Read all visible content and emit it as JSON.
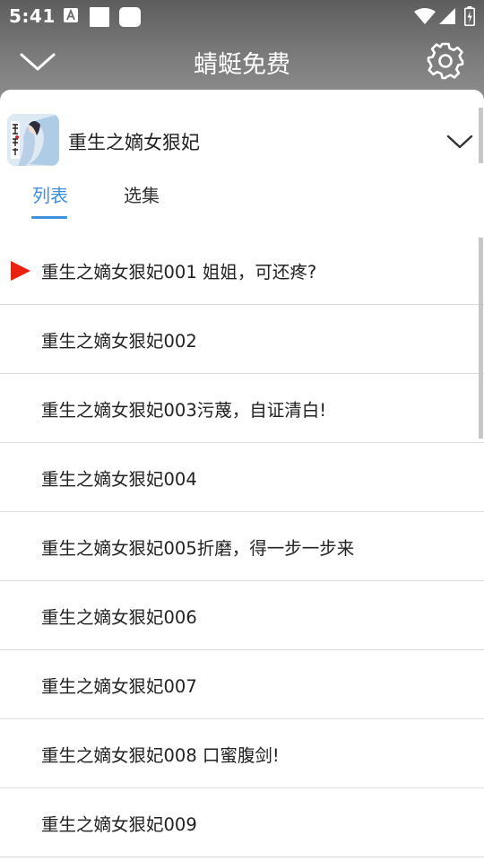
{
  "status_bar": {
    "time": "5:41"
  },
  "top_bar": {
    "title": "蜻蜓免费"
  },
  "book": {
    "title": "重生之嫡女狠妃"
  },
  "tabs": [
    {
      "label": "列表",
      "active": true
    },
    {
      "label": "选集",
      "active": false
    }
  ],
  "episodes": [
    {
      "label": "重生之嫡女狠妃001 姐姐，可还疼?",
      "playing": true
    },
    {
      "label": "重生之嫡女狠妃002",
      "playing": false
    },
    {
      "label": "重生之嫡女狠妃003污蔑，自证清白!",
      "playing": false
    },
    {
      "label": "重生之嫡女狠妃004",
      "playing": false
    },
    {
      "label": "重生之嫡女狠妃005折磨，得一步一步来",
      "playing": false
    },
    {
      "label": "重生之嫡女狠妃006",
      "playing": false
    },
    {
      "label": "重生之嫡女狠妃007",
      "playing": false
    },
    {
      "label": "重生之嫡女狠妃008 口蜜腹剑!",
      "playing": false
    },
    {
      "label": "重生之嫡女狠妃009",
      "playing": false
    }
  ],
  "colors": {
    "accent": "#3d8fe0",
    "playing_indicator": "#e8220f",
    "divider": "#dcdcdc"
  }
}
